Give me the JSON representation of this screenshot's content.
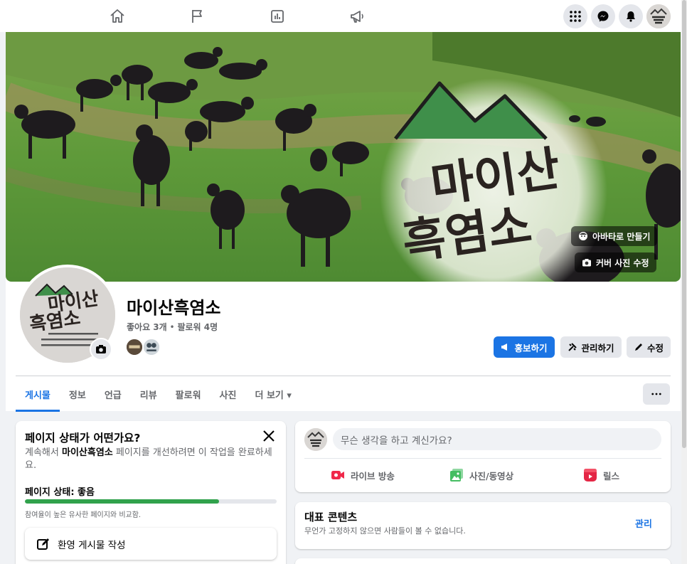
{
  "colors": {
    "accent": "#1b74e4",
    "progress": "#31a24c",
    "background": "#f0f2f5"
  },
  "nav": {
    "icons": [
      "home-icon",
      "flag-icon",
      "insights-icon",
      "megaphone-icon"
    ],
    "right": [
      "menu-grid-icon",
      "messenger-icon",
      "bell-icon",
      "profile-avatar"
    ]
  },
  "cover": {
    "logo_text_1": "마이산",
    "logo_text_2": "흑염소",
    "avatar_button": "아바타로 만들기",
    "edit_cover_button": "커버 사진 수정"
  },
  "profile": {
    "logo_text_1": "마이산",
    "logo_text_2": "흑염소"
  },
  "page": {
    "name": "마이산흑염소",
    "likes": "좋아요 3개",
    "separator": "•",
    "followers": "팔로워 4명"
  },
  "actions": {
    "promote": "홍보하기",
    "manage": "관리하기",
    "edit": "수정"
  },
  "tabs": [
    {
      "label": "게시물",
      "active": true
    },
    {
      "label": "정보"
    },
    {
      "label": "언급"
    },
    {
      "label": "리뷰"
    },
    {
      "label": "팔로워"
    },
    {
      "label": "사진"
    },
    {
      "label": "더 보기 ▾"
    }
  ],
  "status_card": {
    "title": "페이지 상태가 어떤가요?",
    "desc_before": "계속해서 ",
    "desc_bold": "마이산흑염소",
    "desc_after": " 페이지를 개선하려면 이 작업을 완료하세요.",
    "status_label": "페이지 상태: 좋음",
    "progress_fraction": 0.77,
    "compare_note": "참여율이 높은 유사한 페이지와 비교함.",
    "welcome_button": "환영 게시물 작성"
  },
  "composer": {
    "placeholder": "무슨 생각을 하고 계신가요?",
    "live": "라이브 방송",
    "photo": "사진/동영상",
    "reels": "릴스"
  },
  "featured": {
    "title": "대표 콘텐츠",
    "desc": "무언가 고정하지 않으면 사람들이 볼 수 없습니다.",
    "manage": "관리"
  }
}
